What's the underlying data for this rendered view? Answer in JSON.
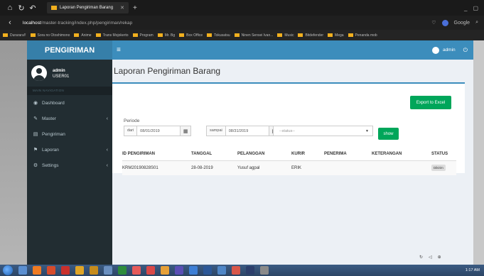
{
  "browser": {
    "tab_title": "Laporan Pengiriman Barang",
    "url_host": "localhost",
    "url_path": "/master-tracking/index.php/pengiriman/rekap",
    "search_engine": "Google",
    "bookmarks": [
      "Durarara!!",
      "Sora no Otoshimono",
      "Anime",
      "Trans Mojokerto",
      "Program",
      "Mr. Bg",
      "Box Office",
      "Tokusatsu",
      "Ninen Sensei Ivan...",
      "Music",
      "Bitdefender",
      "Mega",
      "Penanda mob"
    ]
  },
  "app": {
    "brand": "PENGIRIMAN",
    "user": {
      "name": "admin",
      "role": "USER01"
    },
    "topbar_user": "admin",
    "nav_header": "MAIN NAVIGATION",
    "nav": [
      {
        "label": "Dashboard"
      },
      {
        "label": "Master"
      },
      {
        "label": "Pengiriman"
      },
      {
        "label": "Laporan"
      },
      {
        "label": "Settings"
      }
    ]
  },
  "page": {
    "title": "Laporan Pengiriman Barang",
    "export_label": "Export to Excel",
    "periode_label": "Periode",
    "from_label": "dari",
    "from_value": "08/01/2019",
    "to_label": "sampai",
    "to_value": "08/31/2019",
    "status_placeholder": "--status--",
    "show_label": "show"
  },
  "table": {
    "columns": [
      "ID PENGIRIMAN",
      "TANGGAL",
      "PELANGGAN",
      "KURIR",
      "PENERIMA",
      "KETERANGAN",
      "STATUS"
    ],
    "rows": [
      {
        "id": "KRM20190828S01",
        "tanggal": "28-08-2019",
        "pelanggan": "Yusuf agpal",
        "kurir": "ERIK",
        "penerima": "",
        "keterangan": "",
        "status": "Dikirim"
      }
    ]
  },
  "taskbar": {
    "time": "1:17 AM"
  },
  "colors": {
    "primary": "#3c8dbc",
    "brand": "#367fa9",
    "sidebar": "#222d32",
    "success": "#00a65a"
  }
}
